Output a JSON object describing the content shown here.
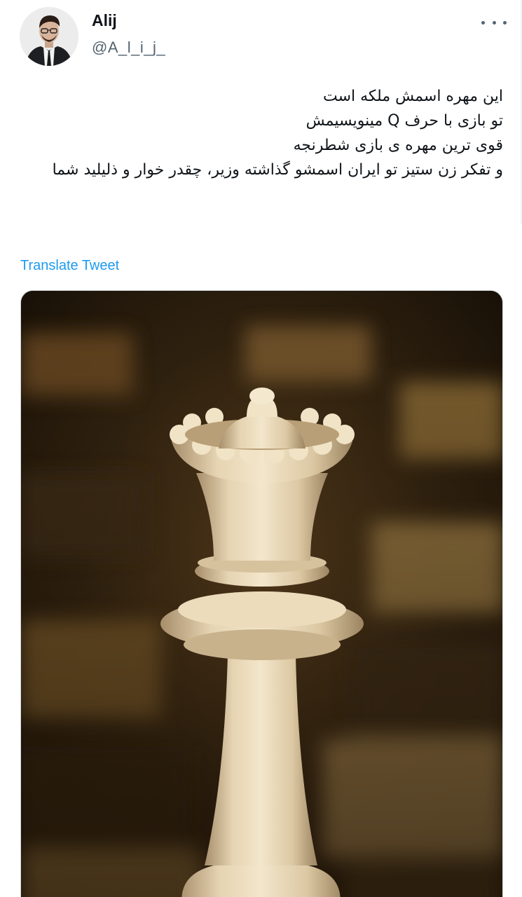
{
  "author": {
    "name": "Alij",
    "handle": "@A_l_i_j_"
  },
  "menu": {
    "icon": "more-horizontal-icon"
  },
  "tweet": {
    "lines": [
      "این مهره اسمش ملکه است",
      "تو بازی با حرف Q مینویسیمش",
      "قوی ترین مهره ی بازی شطرنجه",
      "و تفکر زن ستیز تو ایران اسمشو گذاشته وزیر، چقدر خوار و ذلیلید شما"
    ]
  },
  "translate_label": "Translate Tweet",
  "colors": {
    "accent": "#1d9bf0",
    "text": "#0f1419",
    "secondary": "#536471"
  }
}
